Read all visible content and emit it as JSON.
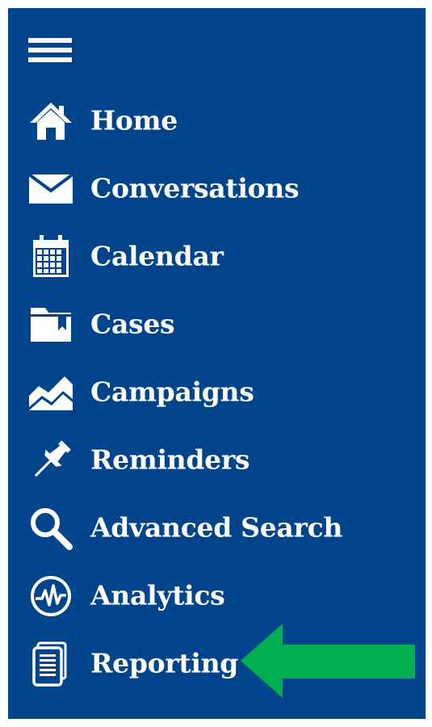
{
  "nav": {
    "items": [
      {
        "label": "Home",
        "icon": "home-icon"
      },
      {
        "label": "Conversations",
        "icon": "envelope-icon"
      },
      {
        "label": "Calendar",
        "icon": "calendar-icon"
      },
      {
        "label": "Cases",
        "icon": "folder-icon"
      },
      {
        "label": "Campaigns",
        "icon": "area-chart-icon"
      },
      {
        "label": "Reminders",
        "icon": "pushpin-icon"
      },
      {
        "label": "Advanced Search",
        "icon": "search-icon"
      },
      {
        "label": "Analytics",
        "icon": "pulse-icon"
      },
      {
        "label": "Reporting",
        "icon": "report-icon"
      }
    ]
  },
  "colors": {
    "sidebar_bg": "#00458b",
    "text": "#ffffff",
    "arrow": "#00b050"
  }
}
